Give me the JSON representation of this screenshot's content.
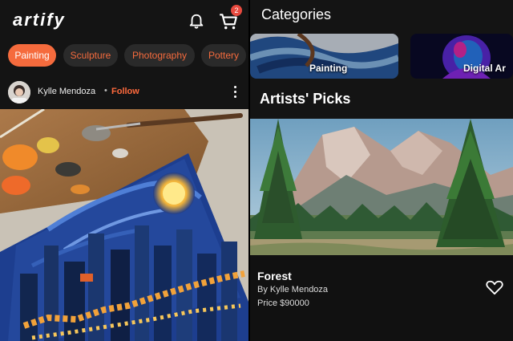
{
  "left": {
    "logo": "artify",
    "cart_badge": "2",
    "chips": [
      {
        "label": "Painting",
        "active": true
      },
      {
        "label": "Sculpture",
        "active": false
      },
      {
        "label": "Photography",
        "active": false
      },
      {
        "label": "Pottery",
        "active": false
      }
    ],
    "author": {
      "name": "Kylle  Mendoza",
      "separator": "•",
      "follow_label": "Follow"
    },
    "icons": [
      "bell-icon",
      "cart-icon",
      "more-vertical-icon"
    ]
  },
  "right": {
    "categories_title": "Categories",
    "categories": [
      {
        "label": "Painting"
      },
      {
        "label": "Digital Ar"
      }
    ],
    "picks_title": "Artists' Picks",
    "pick": {
      "title": "Forest",
      "by": "By Kylle  Mendoza",
      "price": "Price $90000"
    },
    "icons": [
      "heart-icon"
    ]
  },
  "colors": {
    "accent": "#f56b3d",
    "background": "#141414",
    "chip_bg": "#2a2a2a",
    "badge": "#e84a3f"
  }
}
